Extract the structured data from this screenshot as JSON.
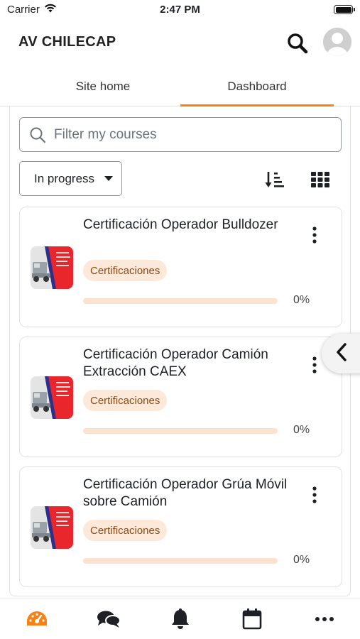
{
  "status": {
    "carrier": "Carrier",
    "time": "2:47 PM"
  },
  "header": {
    "title": "AV CHILECAP",
    "search_icon": "search-icon",
    "avatar_icon": "user-avatar-icon"
  },
  "tabs": [
    {
      "label": "Site home",
      "active": false
    },
    {
      "label": "Dashboard",
      "active": true
    }
  ],
  "dashboard": {
    "search_placeholder": "Filter my courses",
    "filter_label": "In progress",
    "sort_icon": "sort-icon",
    "view_icon": "grid-view-icon"
  },
  "courses": [
    {
      "title": "Certificación Operador Bulldozer",
      "category": "Certificaciones",
      "progress": 0,
      "progress_text": "0%"
    },
    {
      "title": "Certificación Operador Camión Extracción CAEX",
      "category": "Certificaciones",
      "progress": 0,
      "progress_text": "0%"
    },
    {
      "title": "Certificación Operador Grúa Móvil sobre Camión",
      "category": "Certificaciones",
      "progress": 0,
      "progress_text": "0%"
    }
  ],
  "bottom_nav": [
    {
      "icon": "dashboard-gauge-icon",
      "active": true
    },
    {
      "icon": "messages-icon",
      "active": false
    },
    {
      "icon": "notifications-bell-icon",
      "active": false
    },
    {
      "icon": "calendar-icon",
      "active": false
    },
    {
      "icon": "more-icon",
      "active": false
    }
  ],
  "colors": {
    "accent": "#f98012",
    "badge_bg": "#fde9d9",
    "badge_text": "#8a4a15",
    "progress_track": "#fde2cf"
  }
}
